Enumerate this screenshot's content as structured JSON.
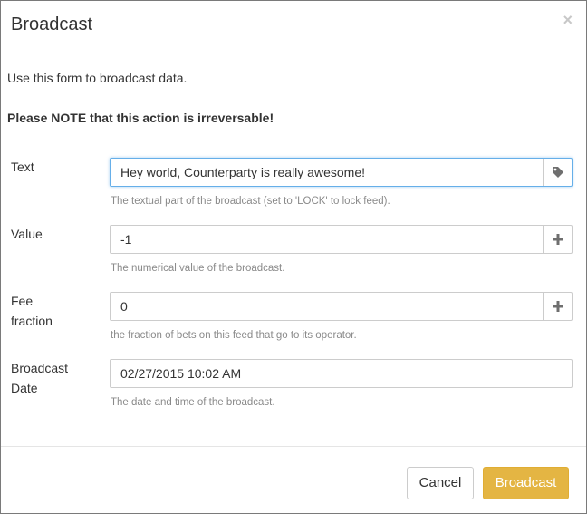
{
  "modal": {
    "title": "Broadcast",
    "close_label": "×",
    "intro": "Use this form to broadcast data.",
    "note": "Please NOTE that this action is irreversable!"
  },
  "form": {
    "text": {
      "label": "Text",
      "value": "Hey world, Counterparty is really awesome!",
      "help": "The textual part of the broadcast (set to 'LOCK' to lock feed).",
      "icon": "tag-icon"
    },
    "value": {
      "label": "Value",
      "value": "-1",
      "help": "The numerical value of the broadcast.",
      "icon": "plus-icon"
    },
    "fee_fraction": {
      "label_line1": "Fee",
      "label_line2": "fraction",
      "value": "0",
      "help": "the fraction of bets on this feed that go to its operator.",
      "icon": "plus-icon"
    },
    "broadcast_date": {
      "label_line1": "Broadcast",
      "label_line2": "Date",
      "value": "02/27/2015 10:02 AM",
      "help": "The date and time of the broadcast."
    }
  },
  "footer": {
    "cancel_label": "Cancel",
    "broadcast_label": "Broadcast"
  },
  "colors": {
    "primary_button": "#e4b543",
    "focus_border": "#66afe9",
    "help_text": "#8a8a8a"
  }
}
